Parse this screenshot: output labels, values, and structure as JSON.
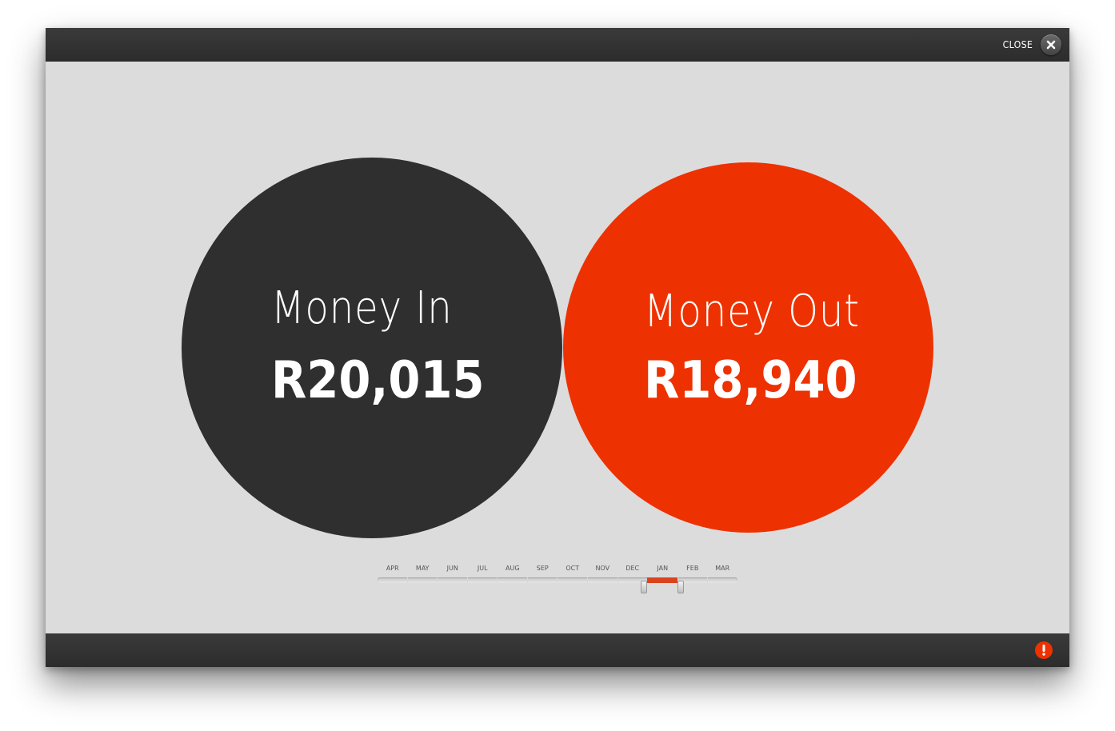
{
  "window": {
    "close_label": "CLOSE"
  },
  "summary": {
    "money_in": {
      "label": "Money In",
      "amount": "R20,015",
      "color": "#2f2f2f"
    },
    "money_out": {
      "label": "Money Out",
      "amount": "R18,940",
      "color": "#ee3100"
    }
  },
  "timeline": {
    "months": [
      "APR",
      "MAY",
      "JUN",
      "JUL",
      "AUG",
      "SEP",
      "OCT",
      "NOV",
      "DEC",
      "JAN",
      "FEB",
      "MAR"
    ],
    "selected_start": "JAN",
    "selected_end": "JAN",
    "accent_color": "#d9441e"
  },
  "icons": {
    "close": "close-icon",
    "alert": "alert-icon"
  }
}
